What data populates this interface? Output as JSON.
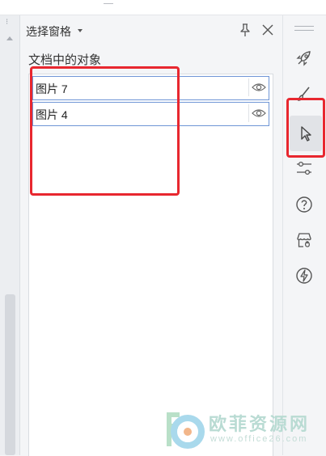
{
  "panel": {
    "title": "选择窗格",
    "section_label": "文档中的对象",
    "items": [
      {
        "label": "图片 7"
      },
      {
        "label": "图片 4"
      }
    ]
  },
  "toolbar": {
    "icons": [
      "rocket-icon",
      "brush-icon",
      "pointer-icon",
      "settings-sliders-icon",
      "help-icon",
      "shop-icon",
      "lightning-icon"
    ],
    "active": "pointer-icon"
  },
  "watermark": {
    "text": "欧菲资源网",
    "url": "www.office26.com"
  },
  "colors": {
    "highlight": "#e8272f",
    "selection_border": "#6f95d6",
    "watermark": "#b9dbd3"
  }
}
